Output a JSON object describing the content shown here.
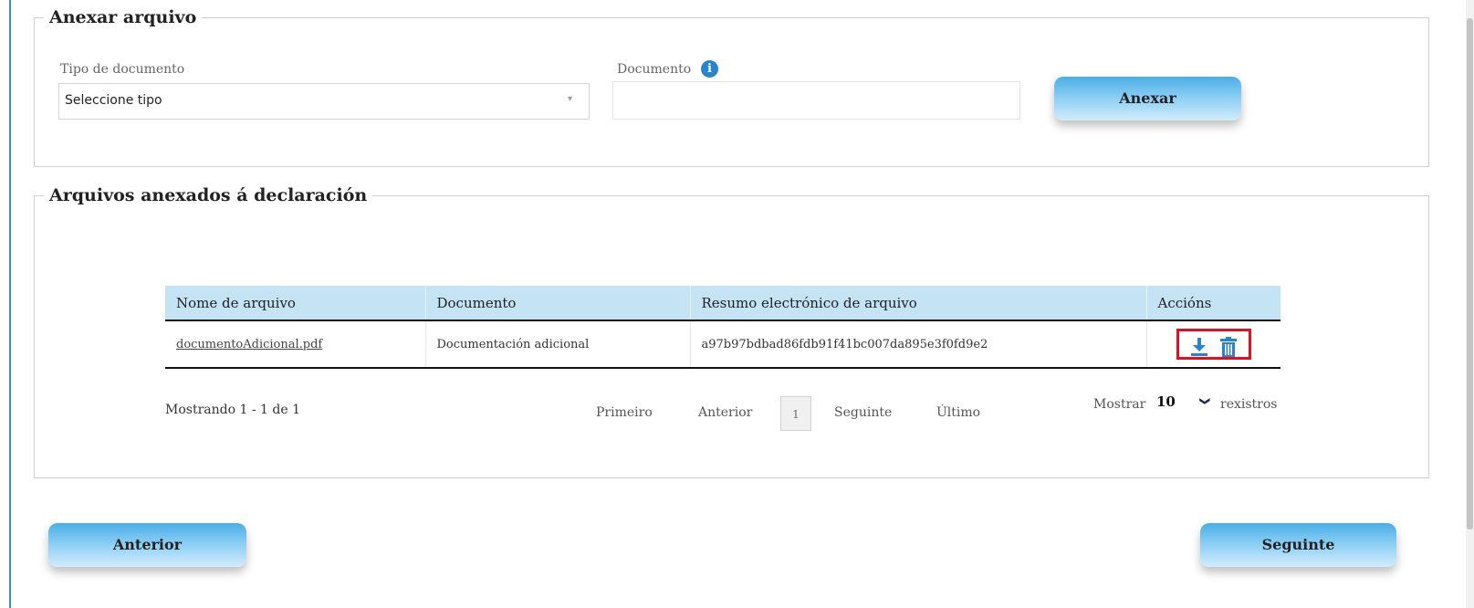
{
  "attach_section": {
    "legend": "Anexar arquivo",
    "doc_type_label": "Tipo de documento",
    "doc_type_value": "Seleccione tipo",
    "document_label": "Documento",
    "document_value": "",
    "attach_button": "Anexar"
  },
  "files_section": {
    "legend": "Arquivos anexados á declaración",
    "columns": [
      "Nome de arquivo",
      "Documento",
      "Resumo electrónico de arquivo",
      "Accións"
    ],
    "rows": [
      {
        "file_name": "documentoAdicional.pdf",
        "document": "Documentación adicional",
        "hash": "a97b97bdbad86fdb91f41bc007da895e3f0fd9e2",
        "actions": [
          "download-icon",
          "trash-icon"
        ]
      }
    ],
    "summary": "Mostrando 1 - 1 de 1",
    "pager": {
      "first": "Primeiro",
      "prev": "Anterior",
      "current_page": "1",
      "next": "Seguinte",
      "last": "Último"
    },
    "show_label": "Mostrar",
    "page_size": "10",
    "records_label": "rexistros"
  },
  "nav": {
    "back": "Anterior",
    "next": "Seguinte"
  },
  "colors": {
    "header_bg": "#c4e3f5",
    "button_top": "#4aaee6",
    "icon_blue": "#2a84c9",
    "highlight_red": "#e0101e"
  }
}
